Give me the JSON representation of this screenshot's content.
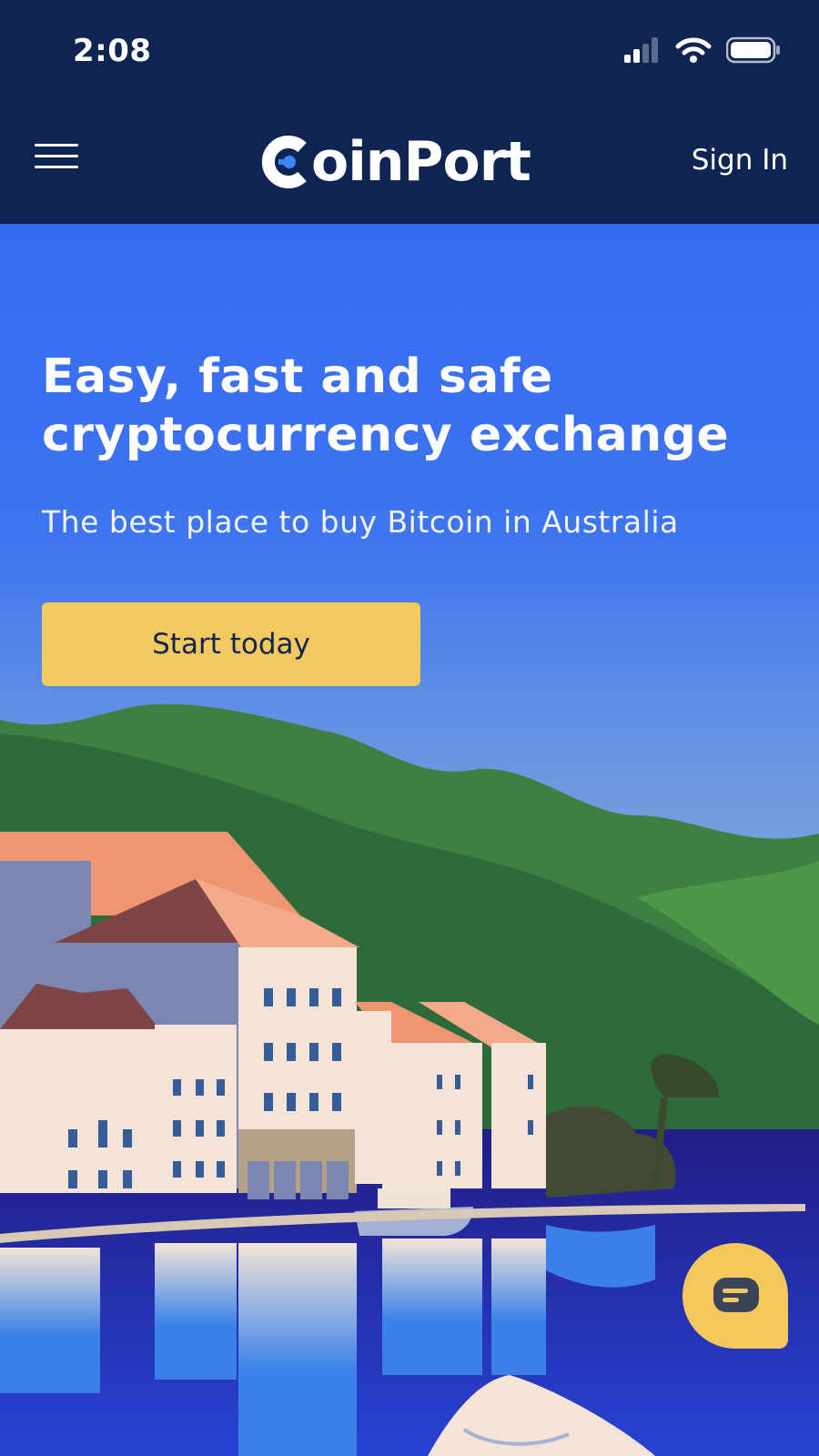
{
  "status_bar": {
    "time": "2:08",
    "signal_icon": "cellular-signal-icon",
    "wifi_icon": "wifi-icon",
    "battery_icon": "battery-icon"
  },
  "navbar": {
    "menu_icon": "hamburger-menu-icon",
    "logo_text": "oinPort",
    "sign_in": "Sign In"
  },
  "hero": {
    "title": "Easy, fast and safe cryptocurrency exchange",
    "subtitle": "The best place to buy Bitcoin in Australia",
    "cta_label": "Start today"
  },
  "chat": {
    "icon": "chat-bubble-icon"
  },
  "colors": {
    "nav_bg": "#0e2453",
    "hero_blue": "#356bf3",
    "cta_yellow": "#f2c95f",
    "cta_text": "#13244d"
  }
}
